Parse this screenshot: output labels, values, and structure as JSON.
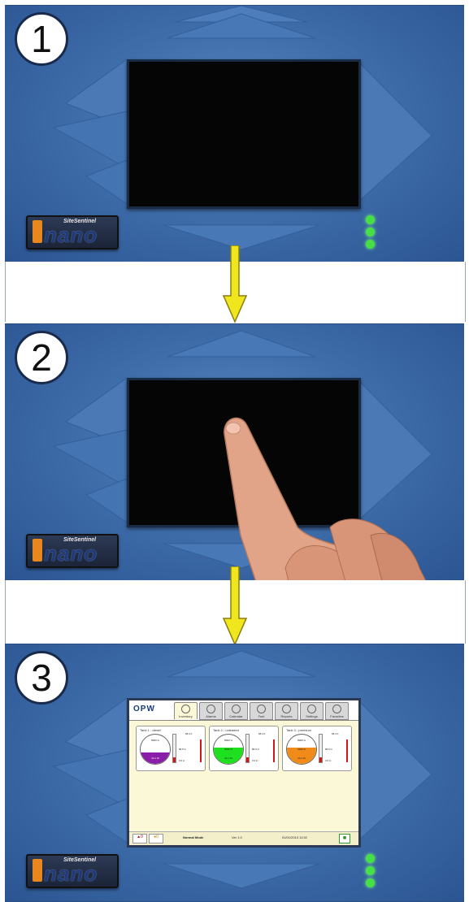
{
  "steps": [
    {
      "number": "1"
    },
    {
      "number": "2"
    },
    {
      "number": "3"
    }
  ],
  "device": {
    "logo_subtitle": "SiteSentinel",
    "logo_word": "nano",
    "led_color": "#46e046",
    "body_color": "#3f6eab",
    "arrow_color": "#f0e61e"
  },
  "ui": {
    "brand": "OPW",
    "tabs": [
      "Inventory",
      "Alarms",
      "Calendar",
      "Fuel",
      "Reports",
      "Settings",
      "Favorites"
    ],
    "tanks": [
      {
        "name": "Tank 1 - diesel",
        "top": "8000 G",
        "mid": "5432 G",
        "bottom": "44.1 IN",
        "fill_color": "#8b1ea8",
        "temp_top": "68.4 F",
        "readout_1": "86.5 in",
        "readout_2": "3.0 in"
      },
      {
        "name": "Tank 2 - unleaded",
        "top": "8000 G",
        "mid": "5432 G",
        "bottom": "44.1 IN",
        "fill_color": "#1ee01e",
        "temp_top": "68.4 F",
        "readout_1": "86.5 in",
        "readout_2": "3.0 in"
      },
      {
        "name": "Tank 3 - premium",
        "top": "8000 G",
        "mid": "5432 G",
        "bottom": "44.1 IN",
        "fill_color": "#f08a18",
        "temp_top": "68.4 F",
        "readout_1": "86.5 in",
        "readout_2": "3.0 in"
      }
    ],
    "alarm_count": "0",
    "warning_count": "0",
    "mode": "Normal Mode",
    "version": "Ver 1.0",
    "datetime": "01/01/2013 11:52"
  }
}
